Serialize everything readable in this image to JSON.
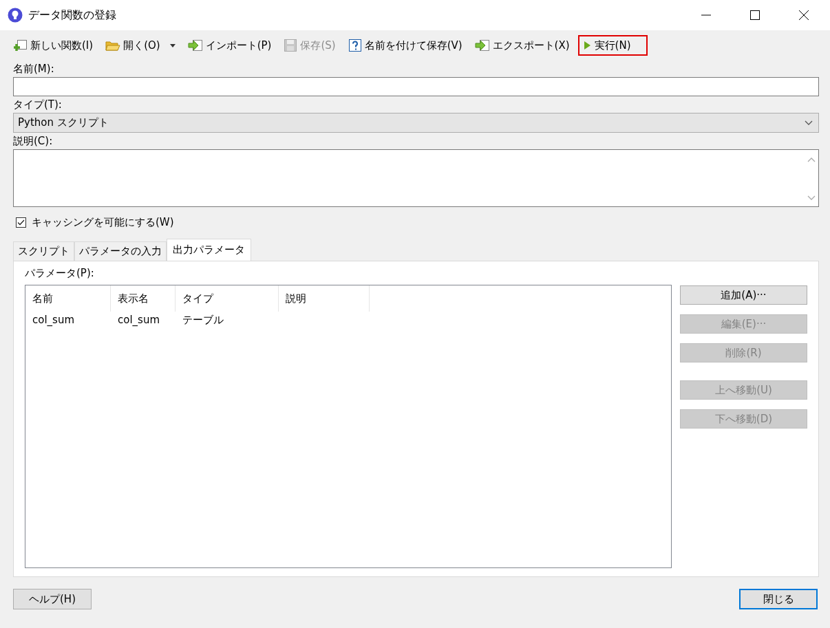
{
  "window": {
    "title": "データ関数の登録"
  },
  "toolbar": [
    {
      "kind": "new",
      "label": "新しい関数(I)",
      "disabled": false,
      "dropdown": false,
      "highlighted": false
    },
    {
      "kind": "open",
      "label": "開く(O)",
      "disabled": false,
      "dropdown": true,
      "highlighted": false
    },
    {
      "kind": "import",
      "label": "インポート(P)",
      "disabled": false,
      "dropdown": false,
      "highlighted": false
    },
    {
      "kind": "save",
      "label": "保存(S)",
      "disabled": true,
      "dropdown": false,
      "highlighted": false
    },
    {
      "kind": "saveas",
      "label": "名前を付けて保存(V)",
      "disabled": false,
      "dropdown": false,
      "highlighted": false
    },
    {
      "kind": "export",
      "label": "エクスポート(X)",
      "disabled": false,
      "dropdown": false,
      "highlighted": false
    },
    {
      "kind": "run",
      "label": "実行(N)",
      "disabled": false,
      "dropdown": false,
      "highlighted": true
    }
  ],
  "name_field": {
    "label": "名前(M):"
  },
  "type_field": {
    "label": "タイプ(T):",
    "value": "Python スクリプト"
  },
  "description_field": {
    "label": "説明(C):"
  },
  "caching": {
    "label": "キャッシングを可能にする(W)",
    "checked": true
  },
  "tabs": [
    {
      "label": "スクリプト",
      "selected": false
    },
    {
      "label": "パラメータの入力",
      "selected": false
    },
    {
      "label": "出力パラメータ",
      "selected": true
    }
  ],
  "parameters": {
    "label": "パラメータ(P):",
    "columns": [
      "名前",
      "表示名",
      "タイプ",
      "説明"
    ],
    "rows": [
      [
        "col_sum",
        "col_sum",
        "テーブル",
        ""
      ]
    ]
  },
  "side_buttons": [
    {
      "label": "追加(A)···",
      "disabled": false
    },
    {
      "label": "編集(E)···",
      "disabled": true
    },
    {
      "label": "削除(R)",
      "disabled": true
    },
    {
      "label": "上へ移動(U)",
      "disabled": true
    },
    {
      "label": "下へ移動(D)",
      "disabled": true
    }
  ],
  "help_button": {
    "label": "ヘルプ(H)"
  },
  "close_button": {
    "label": "閉じる",
    "default": true
  }
}
